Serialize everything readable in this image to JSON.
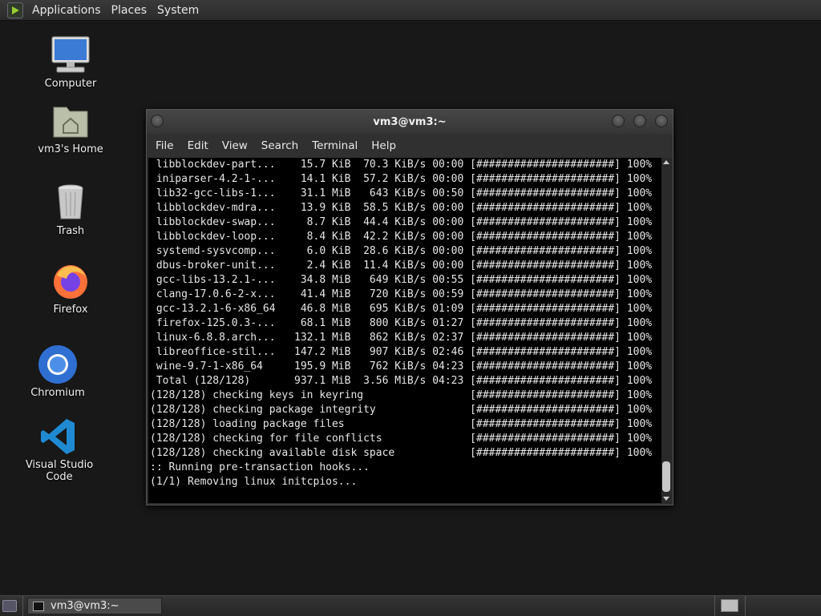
{
  "top_panel": {
    "menus": [
      "Applications",
      "Places",
      "System"
    ]
  },
  "desktop_icons": [
    {
      "label": "Computer",
      "icon": "computer-icon"
    },
    {
      "label": "vm3's Home",
      "icon": "home-folder-icon"
    },
    {
      "label": "Trash",
      "icon": "trash-icon"
    },
    {
      "label": "Firefox",
      "icon": "firefox-icon"
    },
    {
      "label": "Chromium",
      "icon": "chromium-icon"
    },
    {
      "label": "Visual Studio Code",
      "icon": "vscode-icon"
    }
  ],
  "terminal": {
    "title": "vm3@vm3:~",
    "menu": [
      "File",
      "Edit",
      "View",
      "Search",
      "Terminal",
      "Help"
    ],
    "lines": [
      " libblockdev-part...    15.7 KiB  70.3 KiB/s 00:00 [######################] 100%",
      " iniparser-4.2-1-...    14.1 KiB  57.2 KiB/s 00:00 [######################] 100%",
      " lib32-gcc-libs-1...    31.1 MiB   643 KiB/s 00:50 [######################] 100%",
      " libblockdev-mdra...    13.9 KiB  58.5 KiB/s 00:00 [######################] 100%",
      " libblockdev-swap...     8.7 KiB  44.4 KiB/s 00:00 [######################] 100%",
      " libblockdev-loop...     8.4 KiB  42.2 KiB/s 00:00 [######################] 100%",
      " systemd-sysvcomp...     6.0 KiB  28.6 KiB/s 00:00 [######################] 100%",
      " dbus-broker-unit...     2.4 KiB  11.4 KiB/s 00:00 [######################] 100%",
      " gcc-libs-13.2.1-...    34.8 MiB   649 KiB/s 00:55 [######################] 100%",
      " clang-17.0.6-2-x...    41.4 MiB   720 KiB/s 00:59 [######################] 100%",
      " gcc-13.2.1-6-x86_64    46.8 MiB   695 KiB/s 01:09 [######################] 100%",
      " firefox-125.0.3-...    68.1 MiB   800 KiB/s 01:27 [######################] 100%",
      " linux-6.8.8.arch...   132.1 MiB   862 KiB/s 02:37 [######################] 100%",
      " libreoffice-stil...   147.2 MiB   907 KiB/s 02:46 [######################] 100%",
      " wine-9.7-1-x86_64     195.9 MiB   762 KiB/s 04:23 [######################] 100%",
      " Total (128/128)       937.1 MiB  3.56 MiB/s 04:23 [######################] 100%",
      "(128/128) checking keys in keyring                 [######################] 100%",
      "(128/128) checking package integrity               [######################] 100%",
      "(128/128) loading package files                    [######################] 100%",
      "(128/128) checking for file conflicts              [######################] 100%",
      "(128/128) checking available disk space            [######################] 100%",
      ":: Running pre-transaction hooks...",
      "(1/1) Removing linux initcpios..."
    ]
  },
  "taskbar": {
    "task_label": "vm3@vm3:~"
  }
}
